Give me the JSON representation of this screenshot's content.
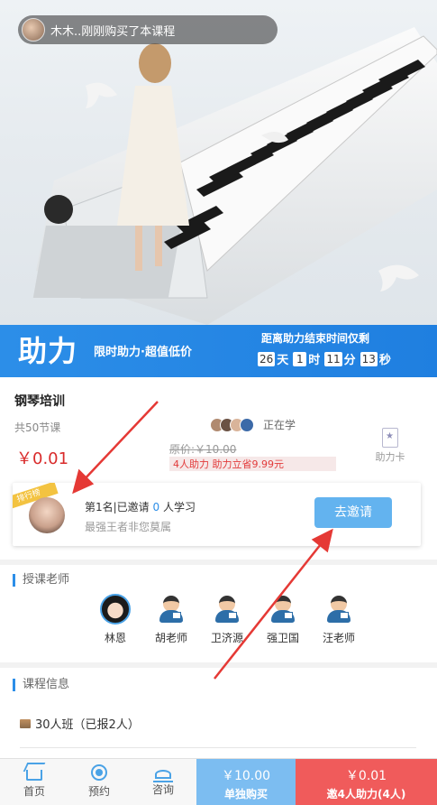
{
  "toast": {
    "text": "木木..刚刚购买了本课程"
  },
  "promo": {
    "title": "助力",
    "subtitle": "限时助力·超值低价",
    "countdown_label": "距离助力结束时间仅剩",
    "days": "26",
    "days_unit": "天",
    "hours": "1",
    "hours_unit": "时",
    "minutes": "11",
    "minutes_unit": "分",
    "seconds": "13",
    "seconds_unit": "秒"
  },
  "course": {
    "title": "钢琴培训",
    "lessons": "共50节课",
    "price": "￥0.01",
    "learners_text": "正在学",
    "original_price": "原价:￥10.00",
    "assist_note": "4人助力 助力立省9.99元",
    "assist_card_label": "助力卡"
  },
  "ranking": {
    "ribbon": "排行榜",
    "line1_prefix": "第1名|已邀请 ",
    "line1_count": "0",
    "line1_suffix": " 人学习",
    "line2": "最强王者非您莫属",
    "invite_button": "去邀请"
  },
  "teachers": {
    "heading": "授课老师",
    "list": [
      "林恩",
      "胡老师",
      "卫济源",
      "强卫国",
      "汪老师"
    ]
  },
  "course_info": {
    "heading": "课程信息",
    "class_text": "30人班（已报2人）"
  },
  "bottom_bar": {
    "home": "首页",
    "booking": "预约",
    "consult": "咨询",
    "single_price": "￥10.00",
    "single_label": "单独购买",
    "group_price": "￥0.01",
    "group_label": "邀4人助力(4人)"
  },
  "colors": {
    "accent": "#2c8ee8",
    "price_red": "#d92b2b",
    "group_button": "#f05b5b",
    "single_button": "#7cbdf1"
  }
}
